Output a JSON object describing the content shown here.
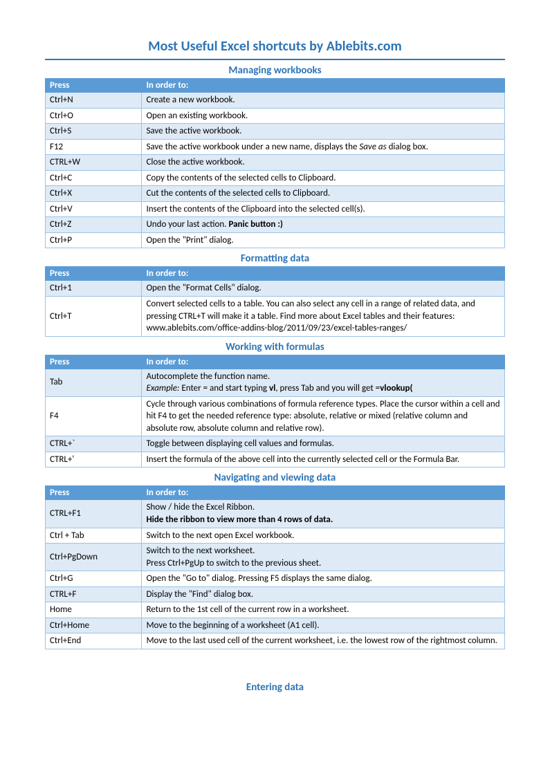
{
  "title": "Most Useful Excel shortcuts by Ablebits.com",
  "header_press": "Press",
  "header_inorder": "In order to:",
  "sections": [
    {
      "title": "Managing workbooks",
      "rows": [
        {
          "alt": true,
          "press": "Ctrl+N",
          "desc": "Create a new workbook."
        },
        {
          "alt": false,
          "press": "Ctrl+O",
          "desc": "Open an existing workbook."
        },
        {
          "alt": true,
          "press": "Ctrl+S",
          "desc": "Save the active workbook."
        },
        {
          "alt": false,
          "press": "F12",
          "desc": "Save the active workbook under a new name, displays the <i>Save as</i>  dialog box."
        },
        {
          "alt": true,
          "press": "CTRL+W",
          "desc": "Close the active workbook."
        },
        {
          "alt": false,
          "press": "Ctrl+C",
          "desc": "Copy the contents of the selected cells to Clipboard."
        },
        {
          "alt": true,
          "press": "Ctrl+X",
          "desc": "Cut the contents of the selected cells to Clipboard."
        },
        {
          "alt": false,
          "press": "Ctrl+V",
          "desc": "Insert the contents of the Clipboard into the selected cell(s)."
        },
        {
          "alt": true,
          "press": "Ctrl+Z",
          "desc": "Undo your last action. <b>Panic button :)</b>"
        },
        {
          "alt": false,
          "press": "Ctrl+P",
          "desc": "Open the \"Print\" dialog."
        }
      ]
    },
    {
      "title": "Formatting data",
      "rows": [
        {
          "alt": true,
          "press": "Ctrl+1",
          "desc": "Open the \"Format Cells\" dialog."
        },
        {
          "alt": false,
          "press": "Ctrl+T",
          "desc": "Convert selected cells to a table.  You can also select any cell in a range of related data, and pressing CTRL+T will make it a table. Find more about Excel tables and their features:<br>www.ablebits.com/office-addins-blog/2011/09/23/excel-tables-ranges/"
        }
      ]
    },
    {
      "title": "Working with formulas",
      "rows": [
        {
          "alt": true,
          "press": "Tab",
          "desc": "Autocomplete the function name.<br><i>Example:</i>  Enter = and start typing <b>vl</b>, press Tab and you will get =<b>vlookup(</b>"
        },
        {
          "alt": false,
          "press": "F4",
          "desc": "Cycle through various combinations of formula reference types. Place the cursor within a cell and hit F4 to get the needed reference type: absolute, relative or mixed (relative column and absolute row, absolute column and relative row)."
        },
        {
          "alt": true,
          "press": "CTRL+`",
          "desc": "Toggle between displaying cell values and formulas."
        },
        {
          "alt": false,
          "press": "CTRL+'",
          "desc": "Insert the formula of the above cell into the currently selected cell or the Formula Bar."
        }
      ]
    },
    {
      "title": "Navigating and viewing data",
      "rows": [
        {
          "alt": true,
          "press": "CTRL+F1",
          "desc": "Show / hide the Excel Ribbon.<br><b>Hide the ribbon to view more than 4 rows of data.</b>"
        },
        {
          "alt": false,
          "press": "Ctrl + Tab",
          "desc": "Switch to the next open Excel workbook."
        },
        {
          "alt": true,
          "press": "Ctrl+PgDown",
          "desc": "Switch to the next worksheet.<br>Press Ctrl+PgUp to switch to the previous sheet."
        },
        {
          "alt": false,
          "press": "Ctrl+G",
          "desc": "Open the \"Go to\" dialog. Pressing F5 displays the same dialog."
        },
        {
          "alt": true,
          "press": "CTRL+F",
          "desc": "Display the \"Find\" dialog box."
        },
        {
          "alt": false,
          "press": "Home",
          "desc": "Return to the 1st cell of the current row in a worksheet."
        },
        {
          "alt": true,
          "press": "Ctrl+Home",
          "desc": "Move to the beginning of a worksheet (A1 cell)."
        },
        {
          "alt": false,
          "press": "Ctrl+End",
          "desc": "Move to the last used cell of the current worksheet, i.e. the lowest row of the rightmost column."
        }
      ]
    }
  ],
  "trailing_section_title": "Entering data"
}
